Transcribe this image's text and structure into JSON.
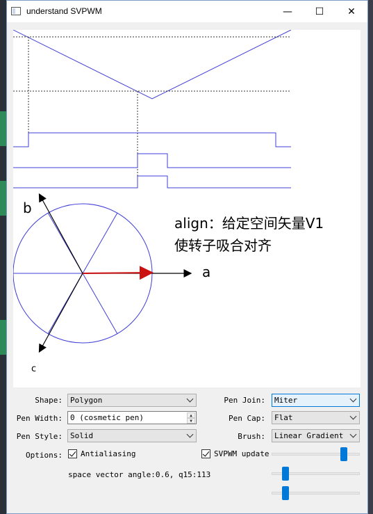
{
  "window": {
    "title": "understand SVPWM"
  },
  "titlebar": {
    "minimize": "—",
    "maximize": "☐",
    "close": "✕"
  },
  "canvas": {
    "align_line1": "align：给定空间矢量V1",
    "align_line2": "使转子吸合对齐",
    "axis_a": "a",
    "axis_b": "b",
    "axis_c": "c"
  },
  "controls": {
    "shape_label": "Shape:",
    "shape_value": "Polygon",
    "pen_width_label": "Pen Width:",
    "pen_width_value": "0 (cosmetic pen)",
    "pen_style_label": "Pen Style:",
    "pen_style_value": "Solid",
    "pen_join_label": "Pen Join:",
    "pen_join_value": "Miter",
    "pen_cap_label": "Pen Cap:",
    "pen_cap_value": "Flat",
    "brush_label": "Brush:",
    "brush_value": "Linear Gradient",
    "options_label": "Options:",
    "antialiasing_label": "Antialiasing",
    "svpwm_update_label": "SVPWM update",
    "status_text": "space vector angle:0.6, q15:113"
  },
  "sliders": [
    0.85,
    0.13,
    0.13
  ],
  "colors": {
    "plot_blue": "#3f3fd8",
    "vector_red": "#cc1111",
    "accent": "#0078d7"
  }
}
